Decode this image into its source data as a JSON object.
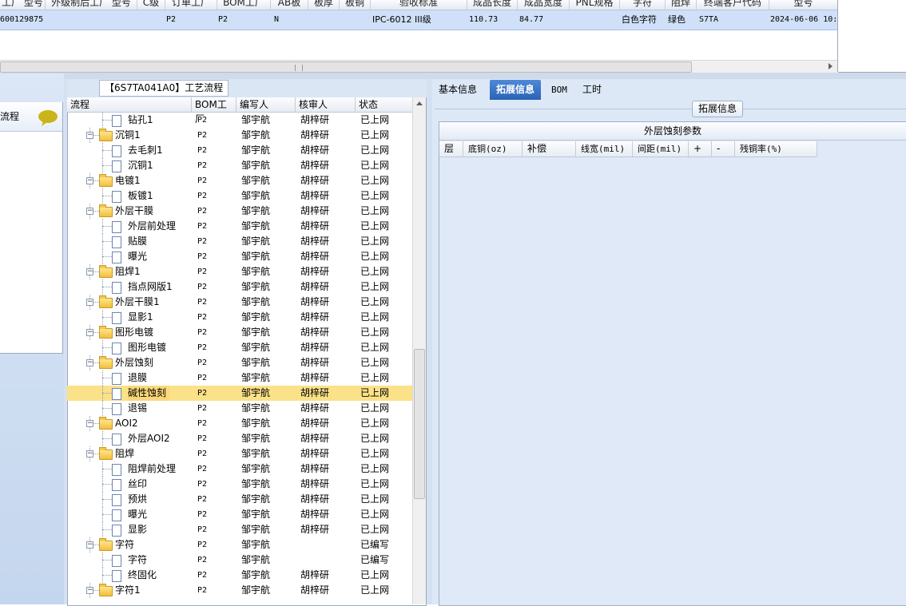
{
  "top_grid": {
    "headers": [
      "工厂 型号",
      "外级制后工厂 型号",
      "C级",
      "订单工厂",
      "BOM工厂",
      "AB板",
      "板厚",
      "板铜",
      "验收标准",
      "成品长度",
      "成品宽度",
      "PNL规格",
      "字符",
      "阻焊",
      "终端客户代码",
      "型号"
    ],
    "row": {
      "id": "600129875",
      "c_level": "P2",
      "order_factory": "P2",
      "ab": "N",
      "standard": "IPC-6012 III级",
      "length": "110.73",
      "width": "84.77",
      "char": "白色字符",
      "solder": "绿色",
      "customer": "S7TA",
      "date": "2024-06-06 10:"
    }
  },
  "left_panel": {
    "label": "流程"
  },
  "tree": {
    "caption": "【6S7TA041A0】工艺流程",
    "headers": [
      "流程",
      "BOM工厂",
      "编写人",
      "核审人",
      "状态"
    ],
    "rows": [
      {
        "name": "钻孔1",
        "type": "doc",
        "factory": "P2",
        "writer": "邹宇航",
        "reviewer": "胡梓研",
        "status": "已上网"
      },
      {
        "name": "沉铜1",
        "type": "folder",
        "factory": "P2",
        "writer": "邹宇航",
        "reviewer": "胡梓研",
        "status": "已上网"
      },
      {
        "name": "去毛刺1",
        "type": "doc",
        "factory": "P2",
        "writer": "邹宇航",
        "reviewer": "胡梓研",
        "status": "已上网"
      },
      {
        "name": "沉铜1",
        "type": "doc",
        "factory": "P2",
        "writer": "邹宇航",
        "reviewer": "胡梓研",
        "status": "已上网"
      },
      {
        "name": "电镀1",
        "type": "folder",
        "factory": "P2",
        "writer": "邹宇航",
        "reviewer": "胡梓研",
        "status": "已上网"
      },
      {
        "name": "板镀1",
        "type": "doc",
        "factory": "P2",
        "writer": "邹宇航",
        "reviewer": "胡梓研",
        "status": "已上网"
      },
      {
        "name": "外层干膜",
        "type": "folder",
        "factory": "P2",
        "writer": "邹宇航",
        "reviewer": "胡梓研",
        "status": "已上网"
      },
      {
        "name": "外层前处理",
        "type": "doc",
        "factory": "P2",
        "writer": "邹宇航",
        "reviewer": "胡梓研",
        "status": "已上网"
      },
      {
        "name": "贴膜",
        "type": "doc",
        "factory": "P2",
        "writer": "邹宇航",
        "reviewer": "胡梓研",
        "status": "已上网"
      },
      {
        "name": "曝光",
        "type": "doc",
        "factory": "P2",
        "writer": "邹宇航",
        "reviewer": "胡梓研",
        "status": "已上网"
      },
      {
        "name": "阻焊1",
        "type": "folder",
        "factory": "P2",
        "writer": "邹宇航",
        "reviewer": "胡梓研",
        "status": "已上网"
      },
      {
        "name": "挡点网版1",
        "type": "doc",
        "factory": "P2",
        "writer": "邹宇航",
        "reviewer": "胡梓研",
        "status": "已上网"
      },
      {
        "name": "外层干膜1",
        "type": "folder",
        "factory": "P2",
        "writer": "邹宇航",
        "reviewer": "胡梓研",
        "status": "已上网"
      },
      {
        "name": "显影1",
        "type": "doc",
        "factory": "P2",
        "writer": "邹宇航",
        "reviewer": "胡梓研",
        "status": "已上网"
      },
      {
        "name": "图形电镀",
        "type": "folder",
        "factory": "P2",
        "writer": "邹宇航",
        "reviewer": "胡梓研",
        "status": "已上网"
      },
      {
        "name": "图形电镀",
        "type": "doc",
        "factory": "P2",
        "writer": "邹宇航",
        "reviewer": "胡梓研",
        "status": "已上网"
      },
      {
        "name": "外层蚀刻",
        "type": "folder",
        "factory": "P2",
        "writer": "邹宇航",
        "reviewer": "胡梓研",
        "status": "已上网"
      },
      {
        "name": "退膜",
        "type": "doc",
        "factory": "P2",
        "writer": "邹宇航",
        "reviewer": "胡梓研",
        "status": "已上网"
      },
      {
        "name": "碱性蚀刻",
        "type": "doc",
        "factory": "P2",
        "writer": "邹宇航",
        "reviewer": "胡梓研",
        "status": "已上网",
        "selected": true
      },
      {
        "name": "退锡",
        "type": "doc",
        "factory": "P2",
        "writer": "邹宇航",
        "reviewer": "胡梓研",
        "status": "已上网"
      },
      {
        "name": "AOI2",
        "type": "folder",
        "factory": "P2",
        "writer": "邹宇航",
        "reviewer": "胡梓研",
        "status": "已上网"
      },
      {
        "name": "外层AOI2",
        "type": "doc",
        "factory": "P2",
        "writer": "邹宇航",
        "reviewer": "胡梓研",
        "status": "已上网"
      },
      {
        "name": "阻焊",
        "type": "folder",
        "factory": "P2",
        "writer": "邹宇航",
        "reviewer": "胡梓研",
        "status": "已上网"
      },
      {
        "name": "阻焊前处理",
        "type": "doc",
        "factory": "P2",
        "writer": "邹宇航",
        "reviewer": "胡梓研",
        "status": "已上网"
      },
      {
        "name": "丝印",
        "type": "doc",
        "factory": "P2",
        "writer": "邹宇航",
        "reviewer": "胡梓研",
        "status": "已上网"
      },
      {
        "name": "预烘",
        "type": "doc",
        "factory": "P2",
        "writer": "邹宇航",
        "reviewer": "胡梓研",
        "status": "已上网"
      },
      {
        "name": "曝光",
        "type": "doc",
        "factory": "P2",
        "writer": "邹宇航",
        "reviewer": "胡梓研",
        "status": "已上网"
      },
      {
        "name": "显影",
        "type": "doc",
        "factory": "P2",
        "writer": "邹宇航",
        "reviewer": "胡梓研",
        "status": "已上网"
      },
      {
        "name": "字符",
        "type": "folder",
        "factory": "P2",
        "writer": "邹宇航",
        "reviewer": "",
        "status": "已编写"
      },
      {
        "name": "字符",
        "type": "doc",
        "factory": "P2",
        "writer": "邹宇航",
        "reviewer": "",
        "status": "已编写"
      },
      {
        "name": "终固化",
        "type": "doc",
        "factory": "P2",
        "writer": "邹宇航",
        "reviewer": "胡梓研",
        "status": "已上网"
      },
      {
        "name": "字符1",
        "type": "folder",
        "factory": "P2",
        "writer": "邹宇航",
        "reviewer": "胡梓研",
        "status": "已上网"
      }
    ]
  },
  "right_panel": {
    "tabs": [
      "基本信息",
      "拓展信息",
      "BOM",
      "工时"
    ],
    "active_tab": "拓展信息",
    "section_caption": "拓展信息",
    "etch_title": "外层蚀刻参数",
    "etch_headers": [
      "层",
      "底铜(oz)",
      "补偿",
      "线宽(mil)",
      "间距(mil)",
      "+",
      "-",
      "残铜率(%)"
    ]
  },
  "colors": {
    "selected_row": "#fbe187",
    "active_tab": "#2a62b6",
    "panel_bg": "#dce8f6"
  }
}
